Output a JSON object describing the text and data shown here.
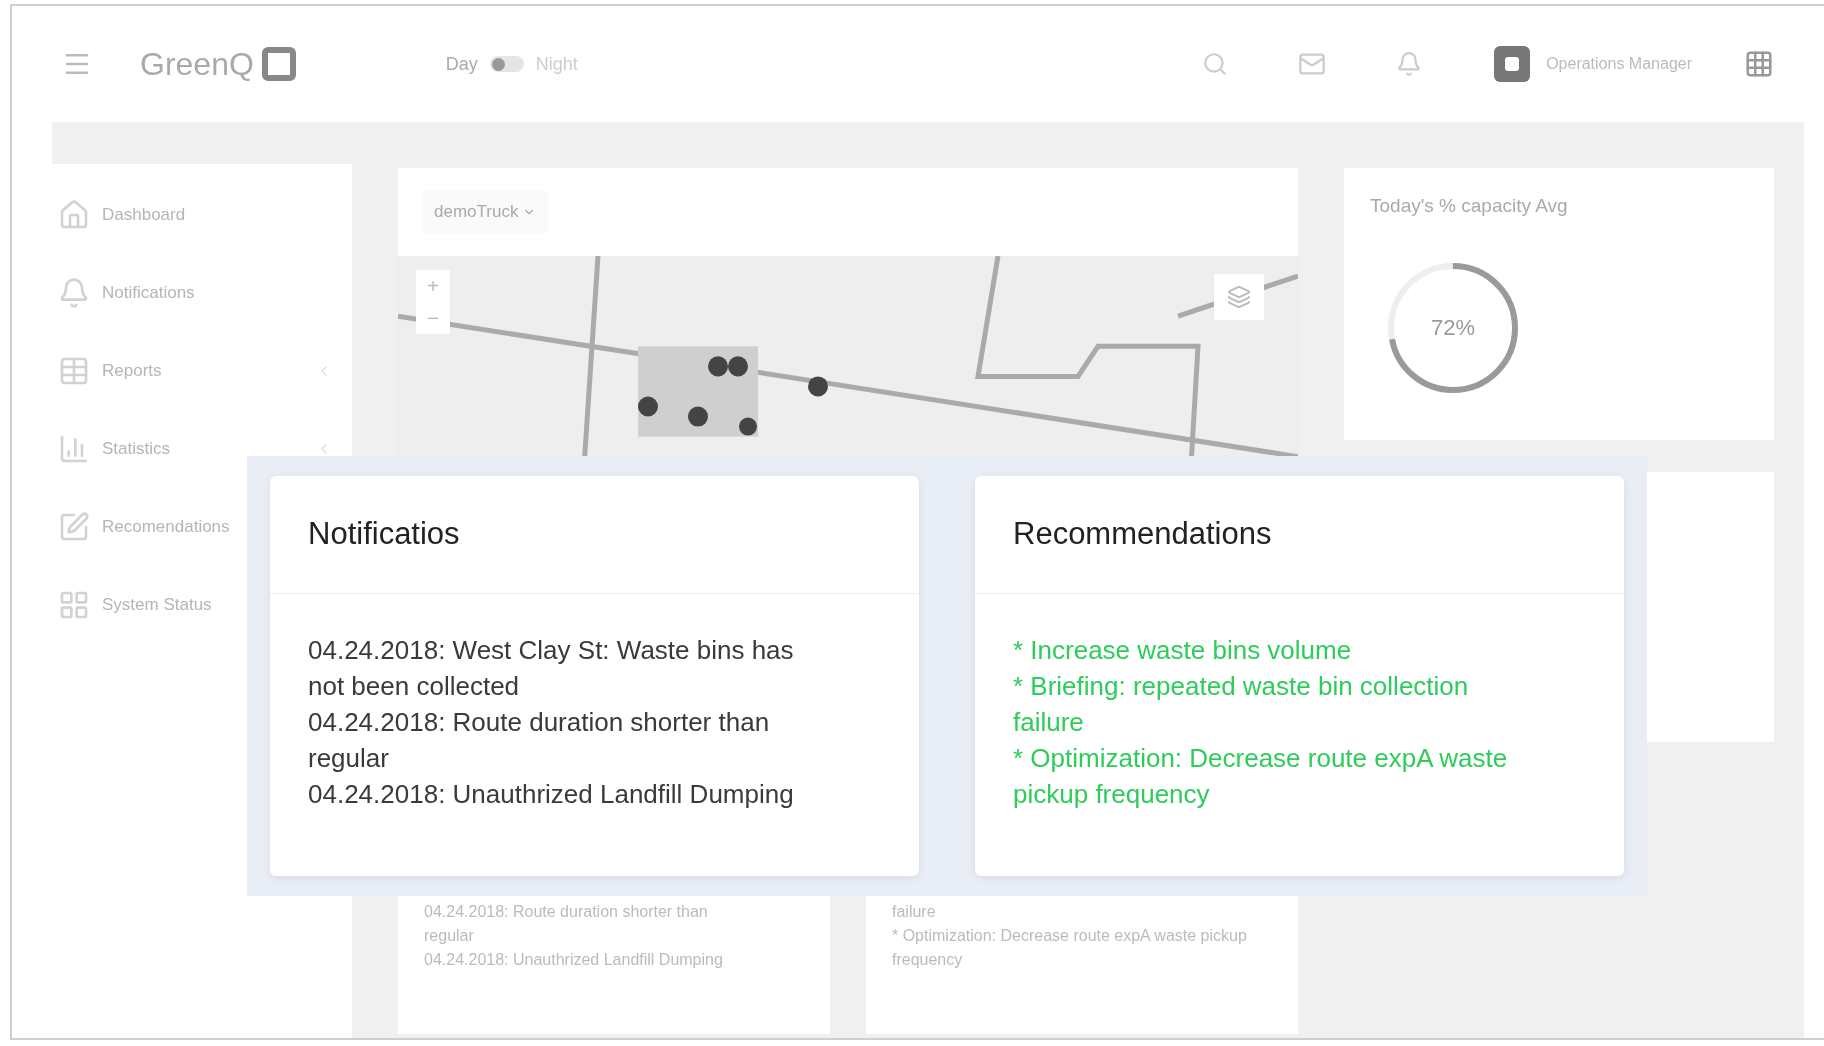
{
  "header": {
    "logo": "GreenQ",
    "mode_toggle": {
      "left_label": "Day",
      "right_label": "Night",
      "night": false
    },
    "user": "Operations Manager"
  },
  "sidebar": {
    "items": [
      {
        "label": "Dashboard",
        "has_submenu": false
      },
      {
        "label": "Notifications",
        "has_submenu": false
      },
      {
        "label": "Reports",
        "has_submenu": true
      },
      {
        "label": "Statistics",
        "has_submenu": true
      },
      {
        "label": "Recomendations",
        "has_submenu": false
      },
      {
        "label": "System Status",
        "has_submenu": false
      }
    ]
  },
  "map_card": {
    "vehicle_select": "demoTruck",
    "zoom_in": "+",
    "zoom_out": "−"
  },
  "capacity_card": {
    "title": "Today's % capacity Avg",
    "value": "72%",
    "level": 0.72
  },
  "background_notifications": {
    "lines": [
      "04.24.2018: Route duration shorter than regular",
      "04.24.2018: Unauthrized Landfill Dumping"
    ]
  },
  "background_recommendations": {
    "lines": [
      "failure",
      "* Optimization: Decrease route expA waste pickup frequency"
    ]
  },
  "popup": {
    "notifications": {
      "title": "Notificatios",
      "items": [
        "04.24.2018: West Clay St: Waste bins has not been collected",
        "04.24.2018: Route duration shorter than regular",
        "04.24.2018: Unauthrized Landfill Dumping"
      ]
    },
    "recommendations": {
      "title": "Recommendations",
      "items": [
        "* Increase waste bins volume",
        "* Briefing: repeated waste bin collection failure",
        "* Optimization: Decrease route expA waste pickup frequency"
      ]
    }
  }
}
